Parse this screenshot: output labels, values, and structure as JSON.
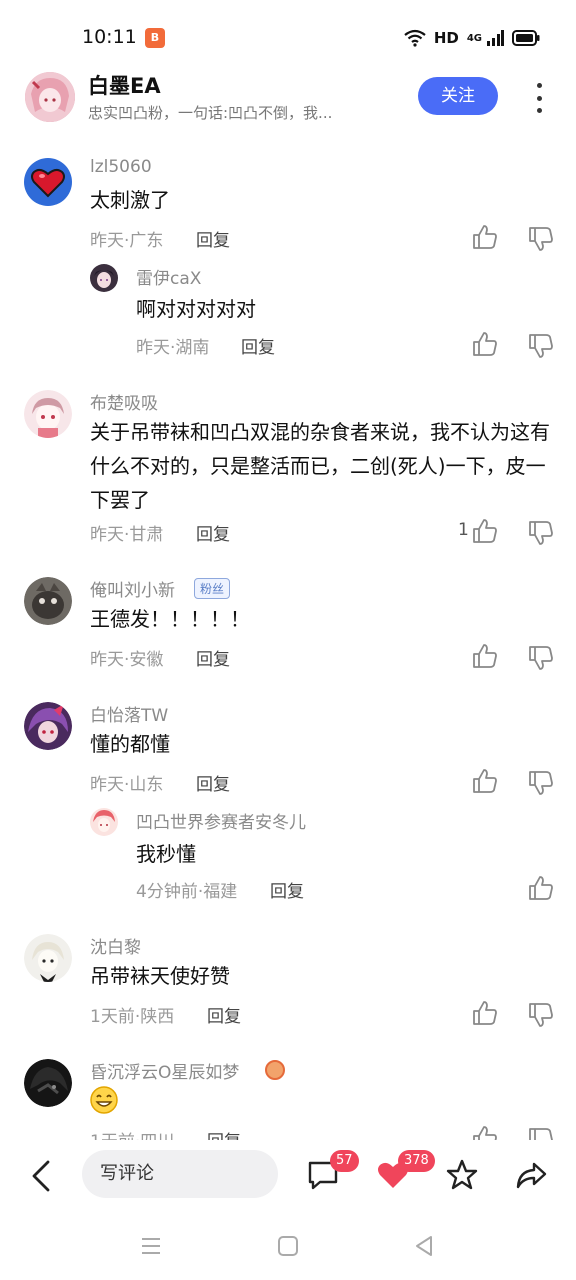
{
  "status": {
    "time": "10:11",
    "hd": "HD",
    "network": "4G"
  },
  "header": {
    "name": "白墨EA",
    "subtitle": "忠实凹凸粉，一句话:凹凸不倒，我...",
    "follow_label": "关注"
  },
  "comments": [
    {
      "username": "lzl5060",
      "text": "太刺激了",
      "meta": "昨天·广东",
      "reply_label": "回复",
      "replies": [
        {
          "username": "雷伊caX",
          "text": "啊对对对对对",
          "meta": "昨天·湖南",
          "reply_label": "回复"
        }
      ]
    },
    {
      "username": "布楚吸吸",
      "text": "关于吊带袜和凹凸双混的杂食者来说，我不认为这有什么不对的，只是整活而已，二创(死人)一下，皮一下罢了",
      "meta": "昨天·甘肃",
      "reply_label": "回复",
      "likes": "1"
    },
    {
      "username": "俺叫刘小新",
      "badge": "粉丝",
      "text": "王德发！！！！！",
      "meta": "昨天·安徽",
      "reply_label": "回复"
    },
    {
      "username": "白怡落TW",
      "text": "懂的都懂",
      "meta": "昨天·山东",
      "reply_label": "回复",
      "replies": [
        {
          "username": "凹凸世界参赛者安冬儿",
          "text": "我秒懂",
          "meta": "4分钟前·福建",
          "reply_label": "回复"
        }
      ]
    },
    {
      "username": "沈白黎",
      "text": "吊带袜天使好赞",
      "meta": "1天前·陕西",
      "reply_label": "回复"
    },
    {
      "username": "昏沉浮云O星辰如梦",
      "text": "",
      "meta": "1天前·四川",
      "reply_label": "回复"
    }
  ],
  "bottom_bar": {
    "input_placeholder": "写评论",
    "comment_count": "57",
    "like_count": "378"
  },
  "colors": {
    "accent": "#4a6cf7",
    "badge": "#f0455b"
  },
  "icons": [
    "back-icon",
    "comment-icon",
    "heart-icon",
    "star-icon",
    "share-icon",
    "thumbs-up-icon",
    "thumbs-down-icon",
    "menu-icon",
    "home-icon",
    "triangle-back-icon"
  ]
}
